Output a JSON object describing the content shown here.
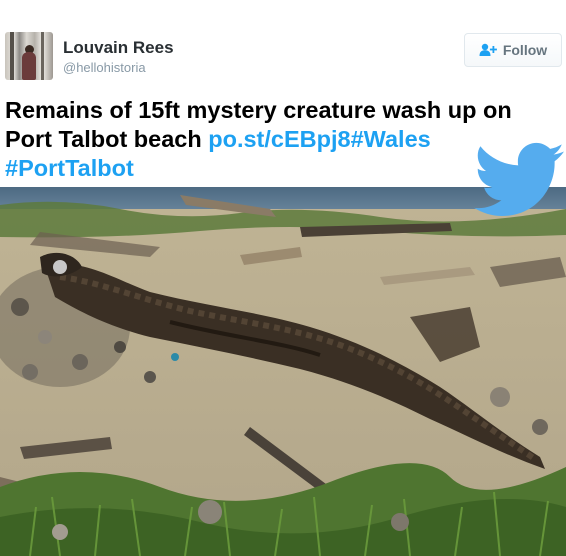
{
  "tweet": {
    "author": {
      "name": "Louvain Rees",
      "handle": "@hellohistoria",
      "avatar_icon": "profile-photo"
    },
    "follow_button": {
      "label": "Follow",
      "icon": "add-user-icon"
    },
    "text": {
      "plain": "Remains of 15ft mystery creature wash up on Port Talbot beach ",
      "link": "po.st/cEBpj8",
      "hashtag1": "#Wales",
      "hashtag2": "#PortTalbot"
    },
    "brand_icon": "twitter-bird-icon",
    "photo": {
      "subject": "decomposed creature carcass on sandy beach with grass and driftwood"
    },
    "colors": {
      "link": "#1da1f2",
      "bird": "#55acee",
      "name": "#292f33",
      "handle": "#8899a6"
    }
  }
}
